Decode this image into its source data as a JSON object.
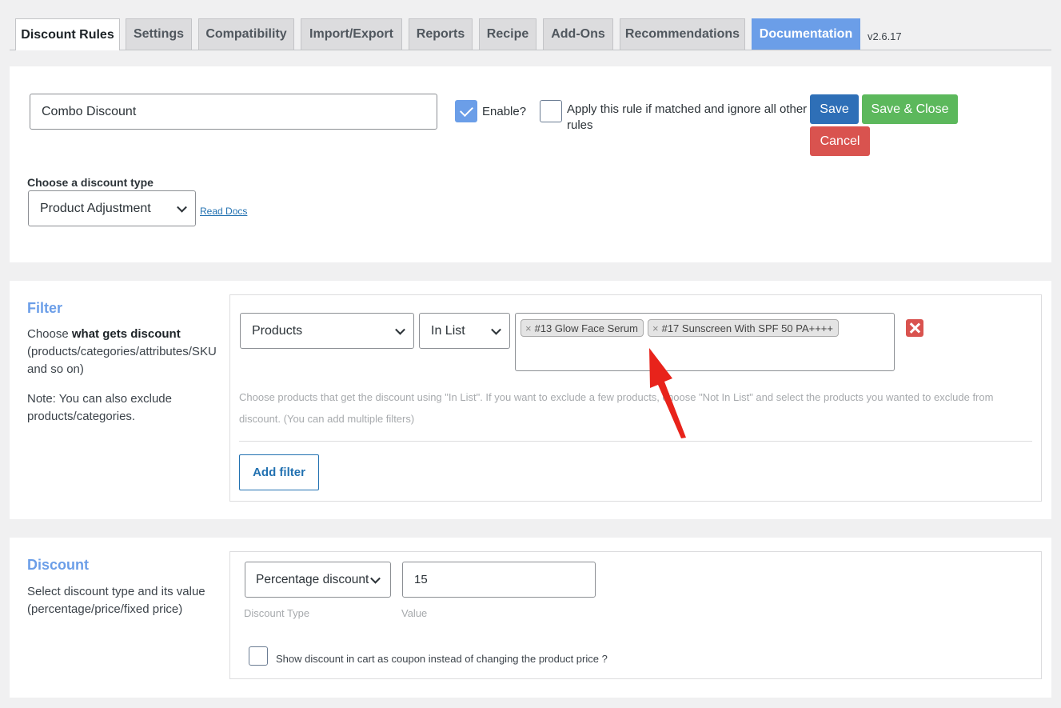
{
  "tabs": [
    "Discount Rules",
    "Settings",
    "Compatibility",
    "Import/Export",
    "Reports",
    "Recipe",
    "Add-Ons",
    "Recommendations",
    "Documentation"
  ],
  "version": "v2.6.17",
  "rule": {
    "name": "Combo Discount",
    "enable_label": "Enable?",
    "enabled": true,
    "exclusive_label_line1": "Apply this rule if matched and ignore all other",
    "exclusive_label_line2": "rules",
    "exclusive": false,
    "save_label": "Save",
    "save_close_label": "Save & Close",
    "cancel_label": "Cancel"
  },
  "discount_type_section": {
    "label": "Choose a discount type",
    "selected": "Product Adjustment",
    "read_docs": "Read Docs"
  },
  "filter": {
    "title": "Filter",
    "desc_prefix": "Choose ",
    "desc_bold": "what gets discount",
    "desc_rest_line1": "(products/categories/attributes/SKU",
    "desc_rest_line2": "and so on)",
    "note_line1": "Note: You can also exclude",
    "note_line2": "products/categories.",
    "type_selected": "Products",
    "condition_selected": "In List",
    "tags": [
      "#13 Glow Face Serum",
      "#17 Sunscreen With SPF 50 PA++++"
    ],
    "tag_remove_symbol": "×",
    "help_text": "Choose products that get the discount using \"In List\". If you want to exclude a few products, choose \"Not In List\" and select the products you wanted to exclude from discount. (You can add multiple filters)",
    "add_filter_label": "Add filter"
  },
  "discount": {
    "title": "Discount",
    "desc_line1": "Select discount type and its value",
    "desc_line2": "(percentage/price/fixed price)",
    "type_selected": "Percentage discount",
    "value": "15",
    "type_caption": "Discount Type",
    "value_caption": "Value",
    "coupon_label": "Show discount in cart as coupon instead of changing the product price ?",
    "coupon_checked": false
  },
  "colors": {
    "accent": "#6b9ee8",
    "save": "#2e6fb7",
    "save_close": "#5cb85c",
    "cancel": "#d9534f",
    "annotation_arrow": "#e8231b"
  }
}
